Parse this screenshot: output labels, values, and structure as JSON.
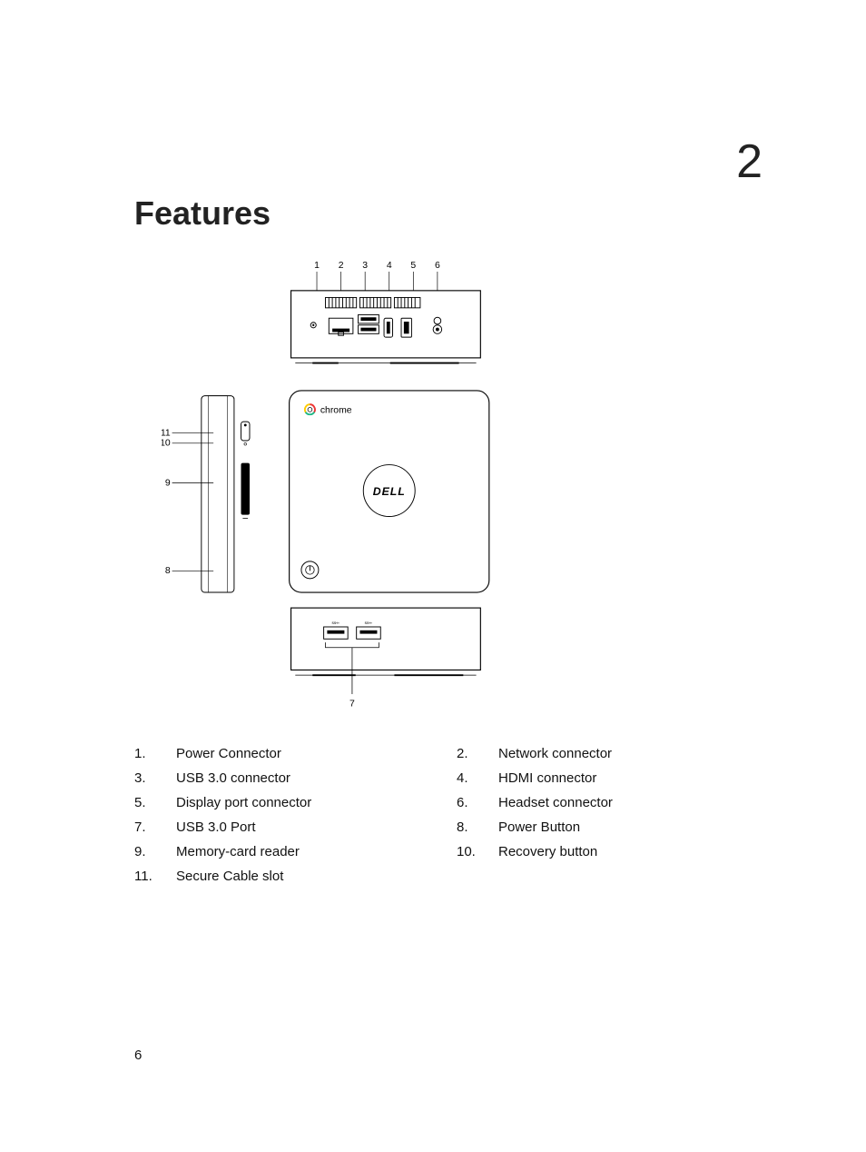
{
  "page": {
    "chapter_number": "2",
    "title": "Features",
    "page_number": "6"
  },
  "diagram": {
    "top_callouts": [
      "1",
      "2",
      "3",
      "4",
      "5",
      "6"
    ],
    "side_callouts": {
      "c11": "11",
      "c10": "10",
      "c9": "9",
      "c8": "8"
    },
    "front_callout": "7",
    "brand_top": "chrome",
    "brand_center": "DELL"
  },
  "legend": {
    "left": [
      {
        "n": "1.",
        "t": "Power Connector"
      },
      {
        "n": "3.",
        "t": "USB 3.0 connector"
      },
      {
        "n": "5.",
        "t": "Display port connector"
      },
      {
        "n": "7.",
        "t": "USB 3.0 Port"
      },
      {
        "n": "9.",
        "t": "Memory-card reader"
      },
      {
        "n": "11.",
        "t": "Secure Cable slot"
      }
    ],
    "right": [
      {
        "n": "2.",
        "t": "Network connector"
      },
      {
        "n": "4.",
        "t": "HDMI connector"
      },
      {
        "n": "6.",
        "t": "Headset connector"
      },
      {
        "n": "8.",
        "t": "Power Button"
      },
      {
        "n": "10.",
        "t": "Recovery button"
      }
    ]
  }
}
